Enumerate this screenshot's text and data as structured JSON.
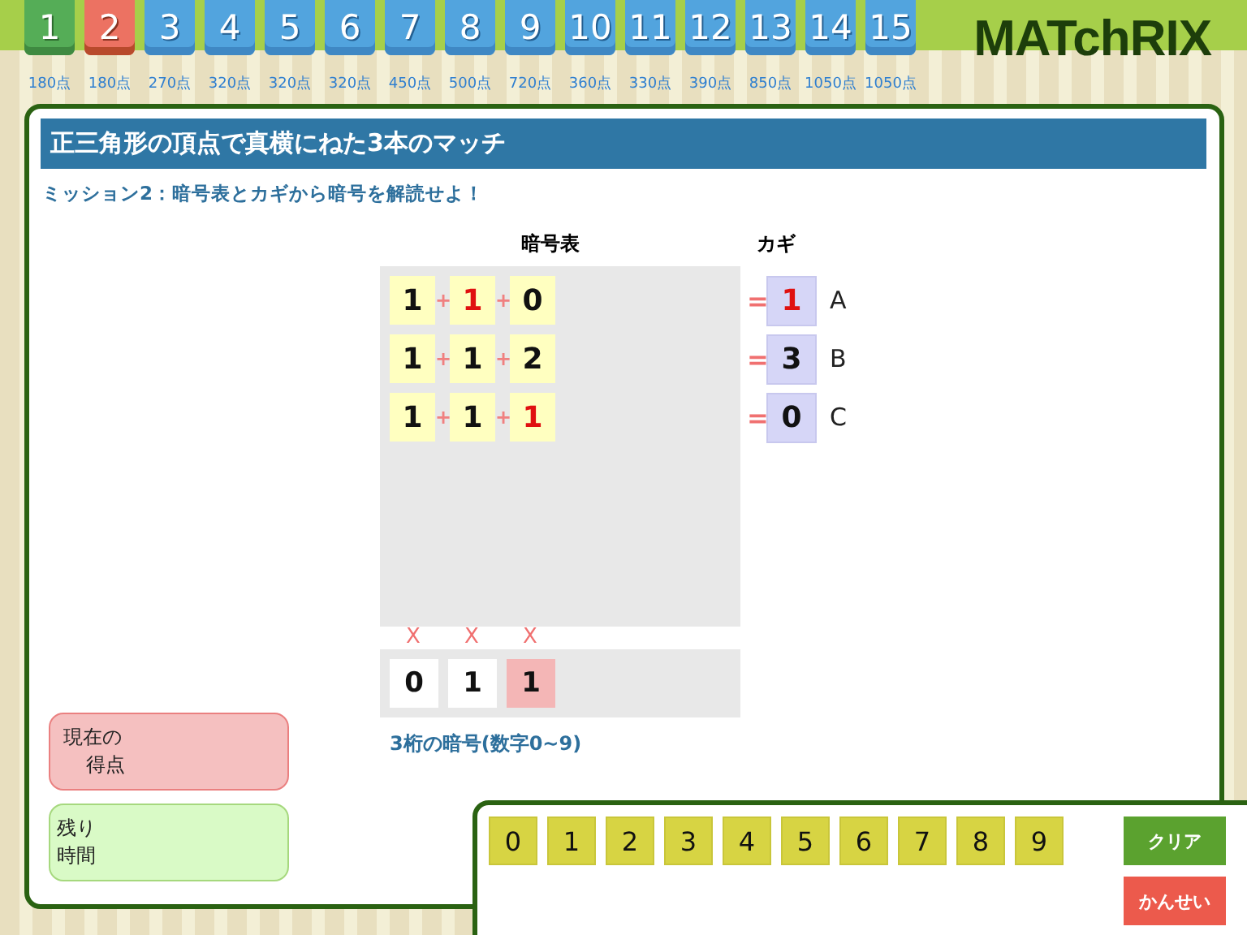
{
  "stages": [
    {
      "number": "1",
      "points": "180点",
      "kind": "cleared",
      "selected": false
    },
    {
      "number": "2",
      "points": "180点",
      "kind": "open",
      "selected": true
    },
    {
      "number": "3",
      "points": "270点",
      "kind": "open",
      "selected": false
    },
    {
      "number": "4",
      "points": "320点",
      "kind": "open",
      "selected": false
    },
    {
      "number": "5",
      "points": "320点",
      "kind": "open",
      "selected": false
    },
    {
      "number": "6",
      "points": "320点",
      "kind": "open",
      "selected": false
    },
    {
      "number": "7",
      "points": "450点",
      "kind": "open",
      "selected": false
    },
    {
      "number": "8",
      "points": "500点",
      "kind": "open",
      "selected": false
    },
    {
      "number": "9",
      "points": "720点",
      "kind": "open",
      "selected": false
    },
    {
      "number": "10",
      "points": "360点",
      "kind": "open",
      "selected": false
    },
    {
      "number": "11",
      "points": "330点",
      "kind": "open",
      "selected": false
    },
    {
      "number": "12",
      "points": "390点",
      "kind": "open",
      "selected": false
    },
    {
      "number": "13",
      "points": "850点",
      "kind": "open",
      "selected": false
    },
    {
      "number": "14",
      "points": "1050点",
      "kind": "open",
      "selected": false
    },
    {
      "number": "15",
      "points": "1050点",
      "kind": "open",
      "selected": false
    }
  ],
  "logo": "MATchRIX",
  "title": "正三角形の頂点で真横にねた3本のマッチ",
  "mission": "ミッション2：暗号表とカギから暗号を解読せよ！",
  "cipher_table": {
    "header": "暗号表",
    "key_header": "カギ",
    "rows": [
      {
        "cells": [
          {
            "digit": "1",
            "highlighted": false
          },
          {
            "digit": "1",
            "highlighted": true
          },
          {
            "digit": "0",
            "highlighted": false
          }
        ],
        "operators": [
          "+",
          "+"
        ],
        "equals": "=",
        "key": {
          "digit": "1",
          "highlighted": true
        },
        "key_label": "A"
      },
      {
        "cells": [
          {
            "digit": "1",
            "highlighted": false
          },
          {
            "digit": "1",
            "highlighted": false
          },
          {
            "digit": "2",
            "highlighted": false
          }
        ],
        "operators": [
          "+",
          "+"
        ],
        "equals": "=",
        "key": {
          "digit": "3",
          "highlighted": false
        },
        "key_label": "B"
      },
      {
        "cells": [
          {
            "digit": "1",
            "highlighted": false
          },
          {
            "digit": "1",
            "highlighted": false
          },
          {
            "digit": "1",
            "highlighted": true
          }
        ],
        "operators": [
          "+",
          "+"
        ],
        "equals": "=",
        "key": {
          "digit": "0",
          "highlighted": false
        },
        "key_label": "C"
      }
    ]
  },
  "answer": {
    "marks": [
      "X",
      "X",
      "X"
    ],
    "cells": [
      {
        "digit": "0",
        "selected": false
      },
      {
        "digit": "1",
        "selected": false
      },
      {
        "digit": "1",
        "selected": true
      }
    ],
    "caption": "3桁の暗号(数字0~9)"
  },
  "score": {
    "lines": [
      "現在の",
      "得点"
    ]
  },
  "time": {
    "lines": [
      "残り",
      "時間"
    ]
  },
  "keypad": {
    "digits": [
      "0",
      "1",
      "2",
      "3",
      "4",
      "5",
      "6",
      "7",
      "8",
      "9"
    ],
    "clear": "クリア",
    "submit": "かんせい"
  }
}
